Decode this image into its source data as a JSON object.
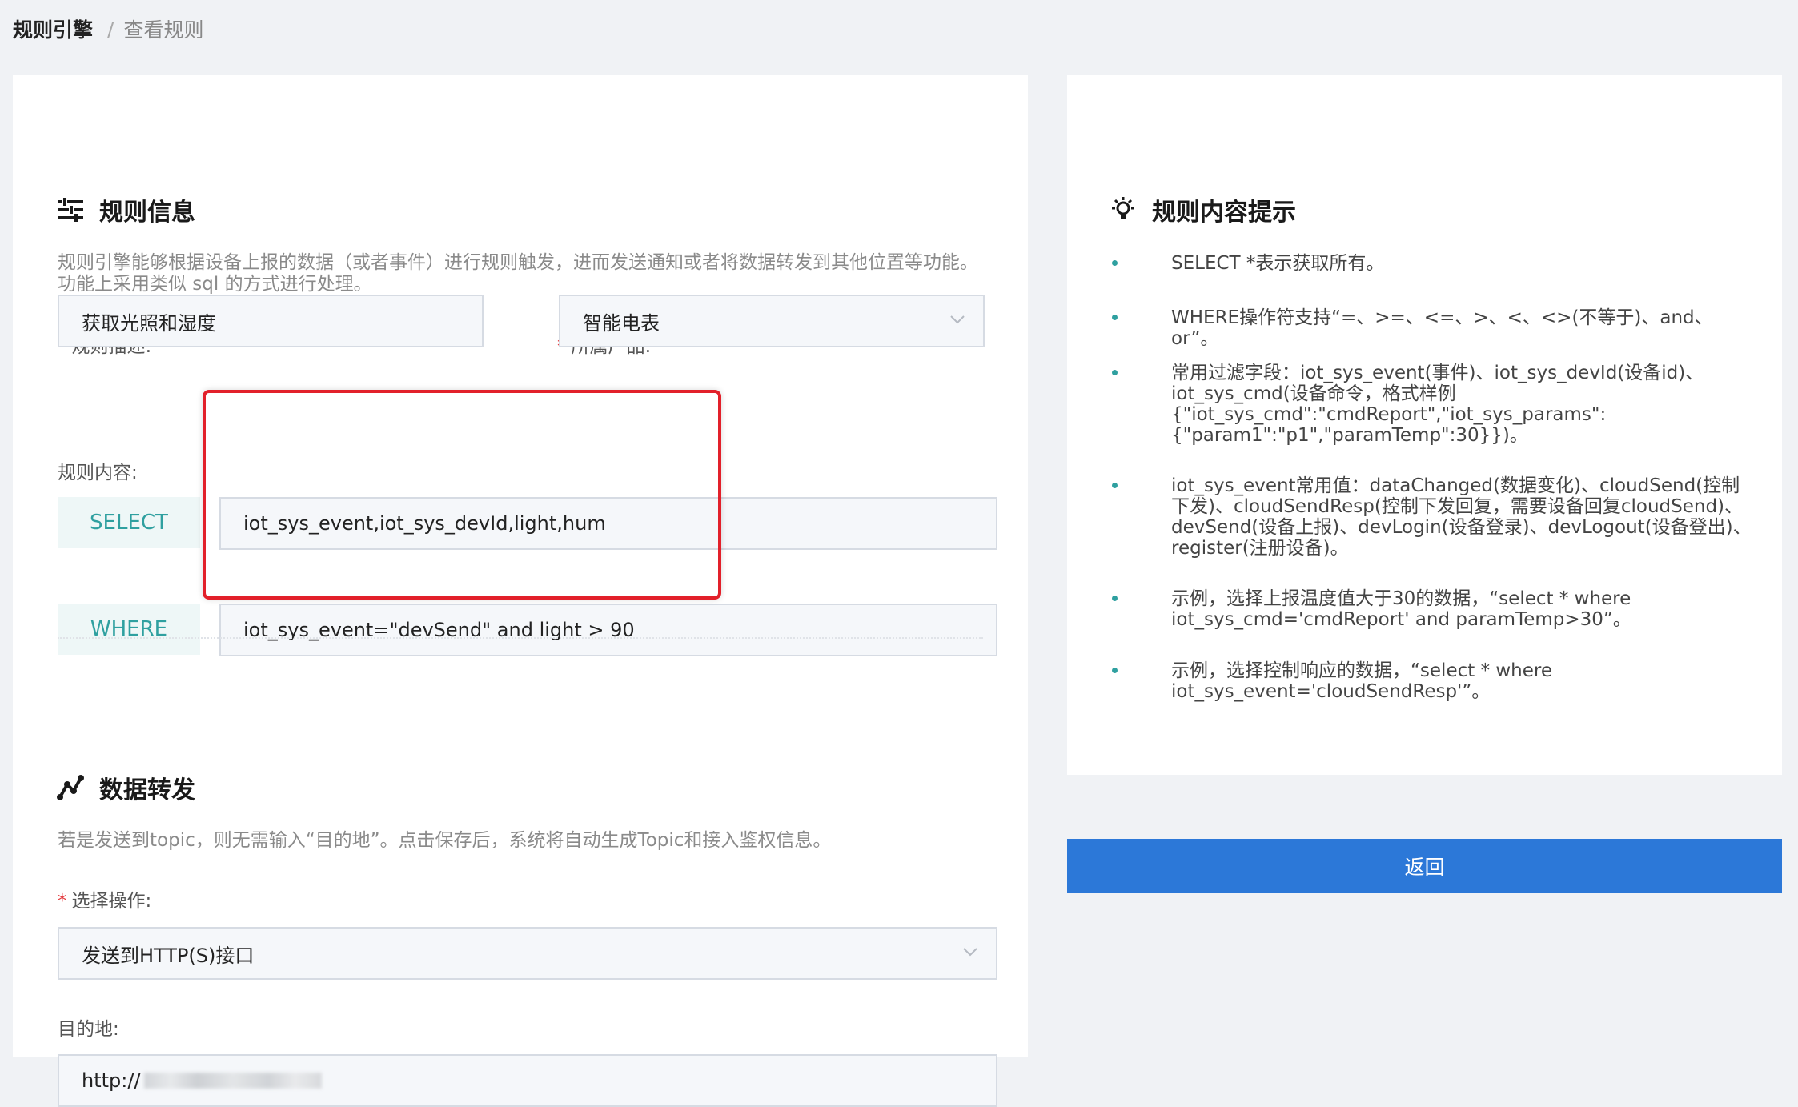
{
  "breadcrumb": {
    "root": "规则引擎",
    "sep": "/",
    "current": "查看规则"
  },
  "rule_info": {
    "title": "规则信息",
    "description": "规则引擎能够根据设备上报的数据（或者事件）进行规则触发，进而发送通知或者将数据转发到其他位置等功能。功能上采用类似 sql 的方式进行处理。",
    "desc_label": "规则描述:",
    "desc_value": "获取光照和湿度",
    "product_label": "所属产品:",
    "product_value": "智能电表",
    "content_label": "规则内容:",
    "select_tag": "SELECT",
    "select_value": "iot_sys_event,iot_sys_devId,light,hum",
    "where_tag": "WHERE",
    "where_value": "iot_sys_event=\"devSend\" and light > 90"
  },
  "forward": {
    "title": "数据转发",
    "description": "若是发送到topic，则无需输入“目的地”。点击保存后，系统将自动生成Topic和接入鉴权信息。",
    "op_label": "选择操作:",
    "op_value": "发送到HTTP(S)接口",
    "dest_label": "目的地:",
    "dest_value": "http://"
  },
  "hints": {
    "title": "规则内容提示",
    "items": [
      "SELECT *表示获取所有。",
      "WHERE操作符支持“=、>=、<=、>、<、<>(不等于)、and、or”。",
      "常用过滤字段：iot_sys_event(事件)、iot_sys_devId(设备id)、iot_sys_cmd(设备命令，格式样例{\"iot_sys_cmd\":\"cmdReport\",\"iot_sys_params\":{\"param1\":\"p1\",\"paramTemp\":30}})。",
      "iot_sys_event常用值：dataChanged(数据变化)、cloudSend(控制下发)、cloudSendResp(控制下发回复，需要设备回复cloudSend)、devSend(设备上报)、devLogin(设备登录)、devLogout(设备登出)、register(注册设备)。",
      "示例，选择上报温度值大于30的数据，“select * where iot_sys_cmd='cmdReport' and paramTemp>30”。",
      "示例，选择控制响应的数据，“select * where iot_sys_event='cloudSendResp'”。"
    ]
  },
  "actions": {
    "return_label": "返回"
  },
  "colors": {
    "accent": "#2c78d8",
    "tag_text": "#2fa0a0",
    "highlight": "#e2202a",
    "required": "#e4393c"
  }
}
